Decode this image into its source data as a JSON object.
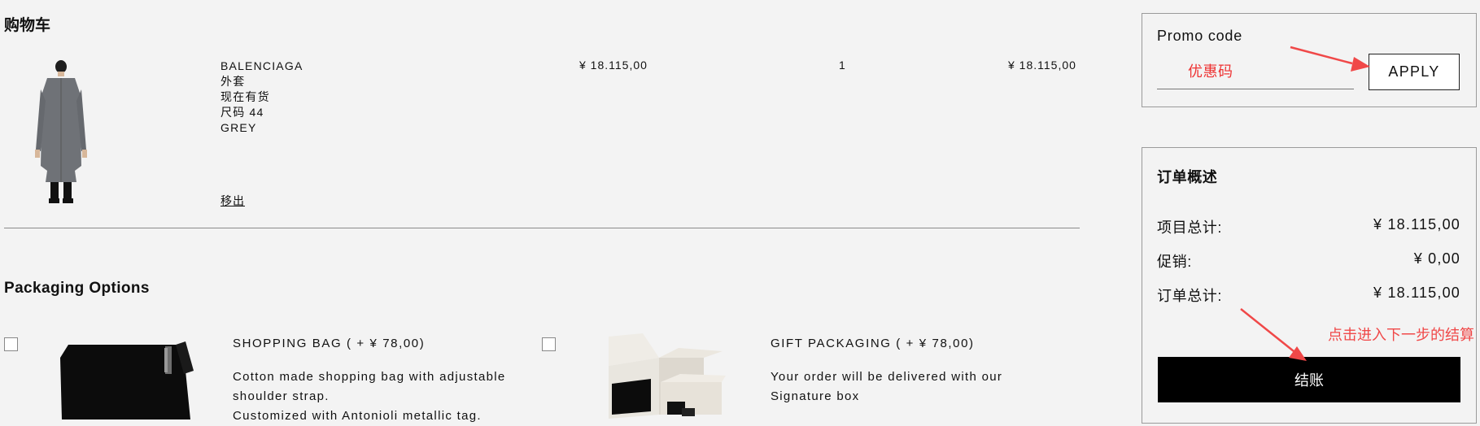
{
  "cart": {
    "title": "购物车",
    "item": {
      "brand": "BALENCIAGA",
      "name": "外套",
      "stock": "现在有货",
      "size": "尺码 44",
      "color": "GREY",
      "unit_price": "¥ 18.115,00",
      "quantity": "1",
      "total": "¥ 18.115,00",
      "remove_label": "移出"
    }
  },
  "packaging": {
    "title": "Packaging Options",
    "options": [
      {
        "label": "SHOPPING BAG ( + ¥ 78,00)",
        "description": [
          "Cotton made shopping bag with adjustable",
          "shoulder strap.",
          "Customized with Antonioli metallic tag."
        ]
      },
      {
        "label": "GIFT PACKAGING ( + ¥ 78,00)",
        "description": [
          "Your order will be delivered with our",
          "Signature box"
        ]
      }
    ]
  },
  "promo": {
    "label": "Promo code",
    "placeholder": "优惠码",
    "apply_label": "APPLY"
  },
  "summary": {
    "title": "订单概述",
    "rows": [
      {
        "label": "项目总计:",
        "value": "¥ 18.115,00"
      },
      {
        "label": "促销:",
        "value": "¥ 0,00"
      },
      {
        "label": "订单总计:",
        "value": "¥ 18.115,00"
      }
    ],
    "checkout_label": "结账"
  },
  "annotations": {
    "checkout_hint": "点击进入下一步的结算"
  },
  "colors": {
    "background": "#f3f3f3",
    "annotation": "#f04848",
    "checkout_button": "#000000"
  }
}
